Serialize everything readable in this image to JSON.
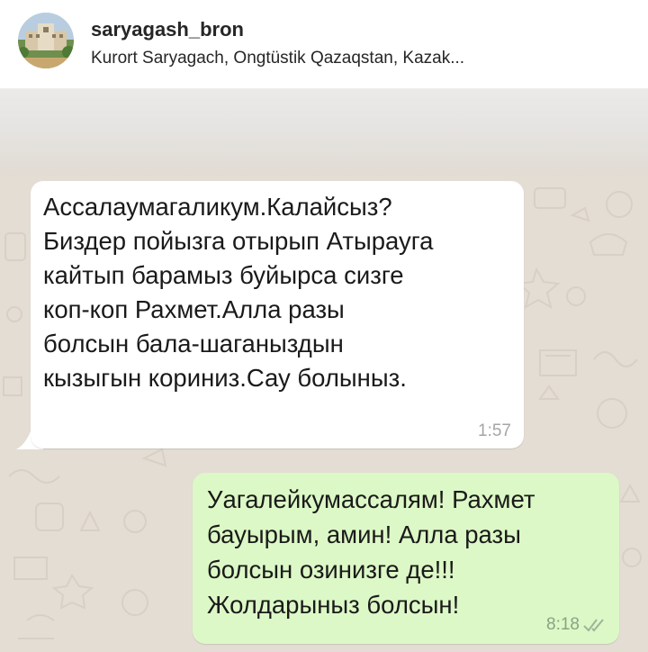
{
  "profile": {
    "username": "saryagash_bron",
    "location": "Kurort Saryagach, Ongtüstik Qazaqstan, Kazak...",
    "avatar_icon": "hotel-building-avatar",
    "more_icon": "more-horizontal-icon"
  },
  "chat": {
    "messages": [
      {
        "direction": "incoming",
        "lines": [
          "Ассалаумагаликум.Калайсыз?",
          "Биздер пойызга отырып Атырауга",
          "кайтып барамыз буйырса сизге",
          "коп-коп Рахмет.Алла разы",
          "болсын бала-шаганыздын",
          "кызыгын кориниз.Сау болыныз."
        ],
        "time": "1:57"
      },
      {
        "direction": "outgoing",
        "lines": [
          "Уагалейкумассалям! Рахмет",
          "бауырым, амин! Алла разы",
          "болсын озинизге де!!!",
          "Жолдарыныз болсын!"
        ],
        "time": "8:18",
        "status_icon": "double-check-icon"
      }
    ]
  },
  "colors": {
    "chat_background": "#e4ddd4",
    "incoming_bubble": "#ffffff",
    "outgoing_bubble": "#dcf8c6"
  }
}
